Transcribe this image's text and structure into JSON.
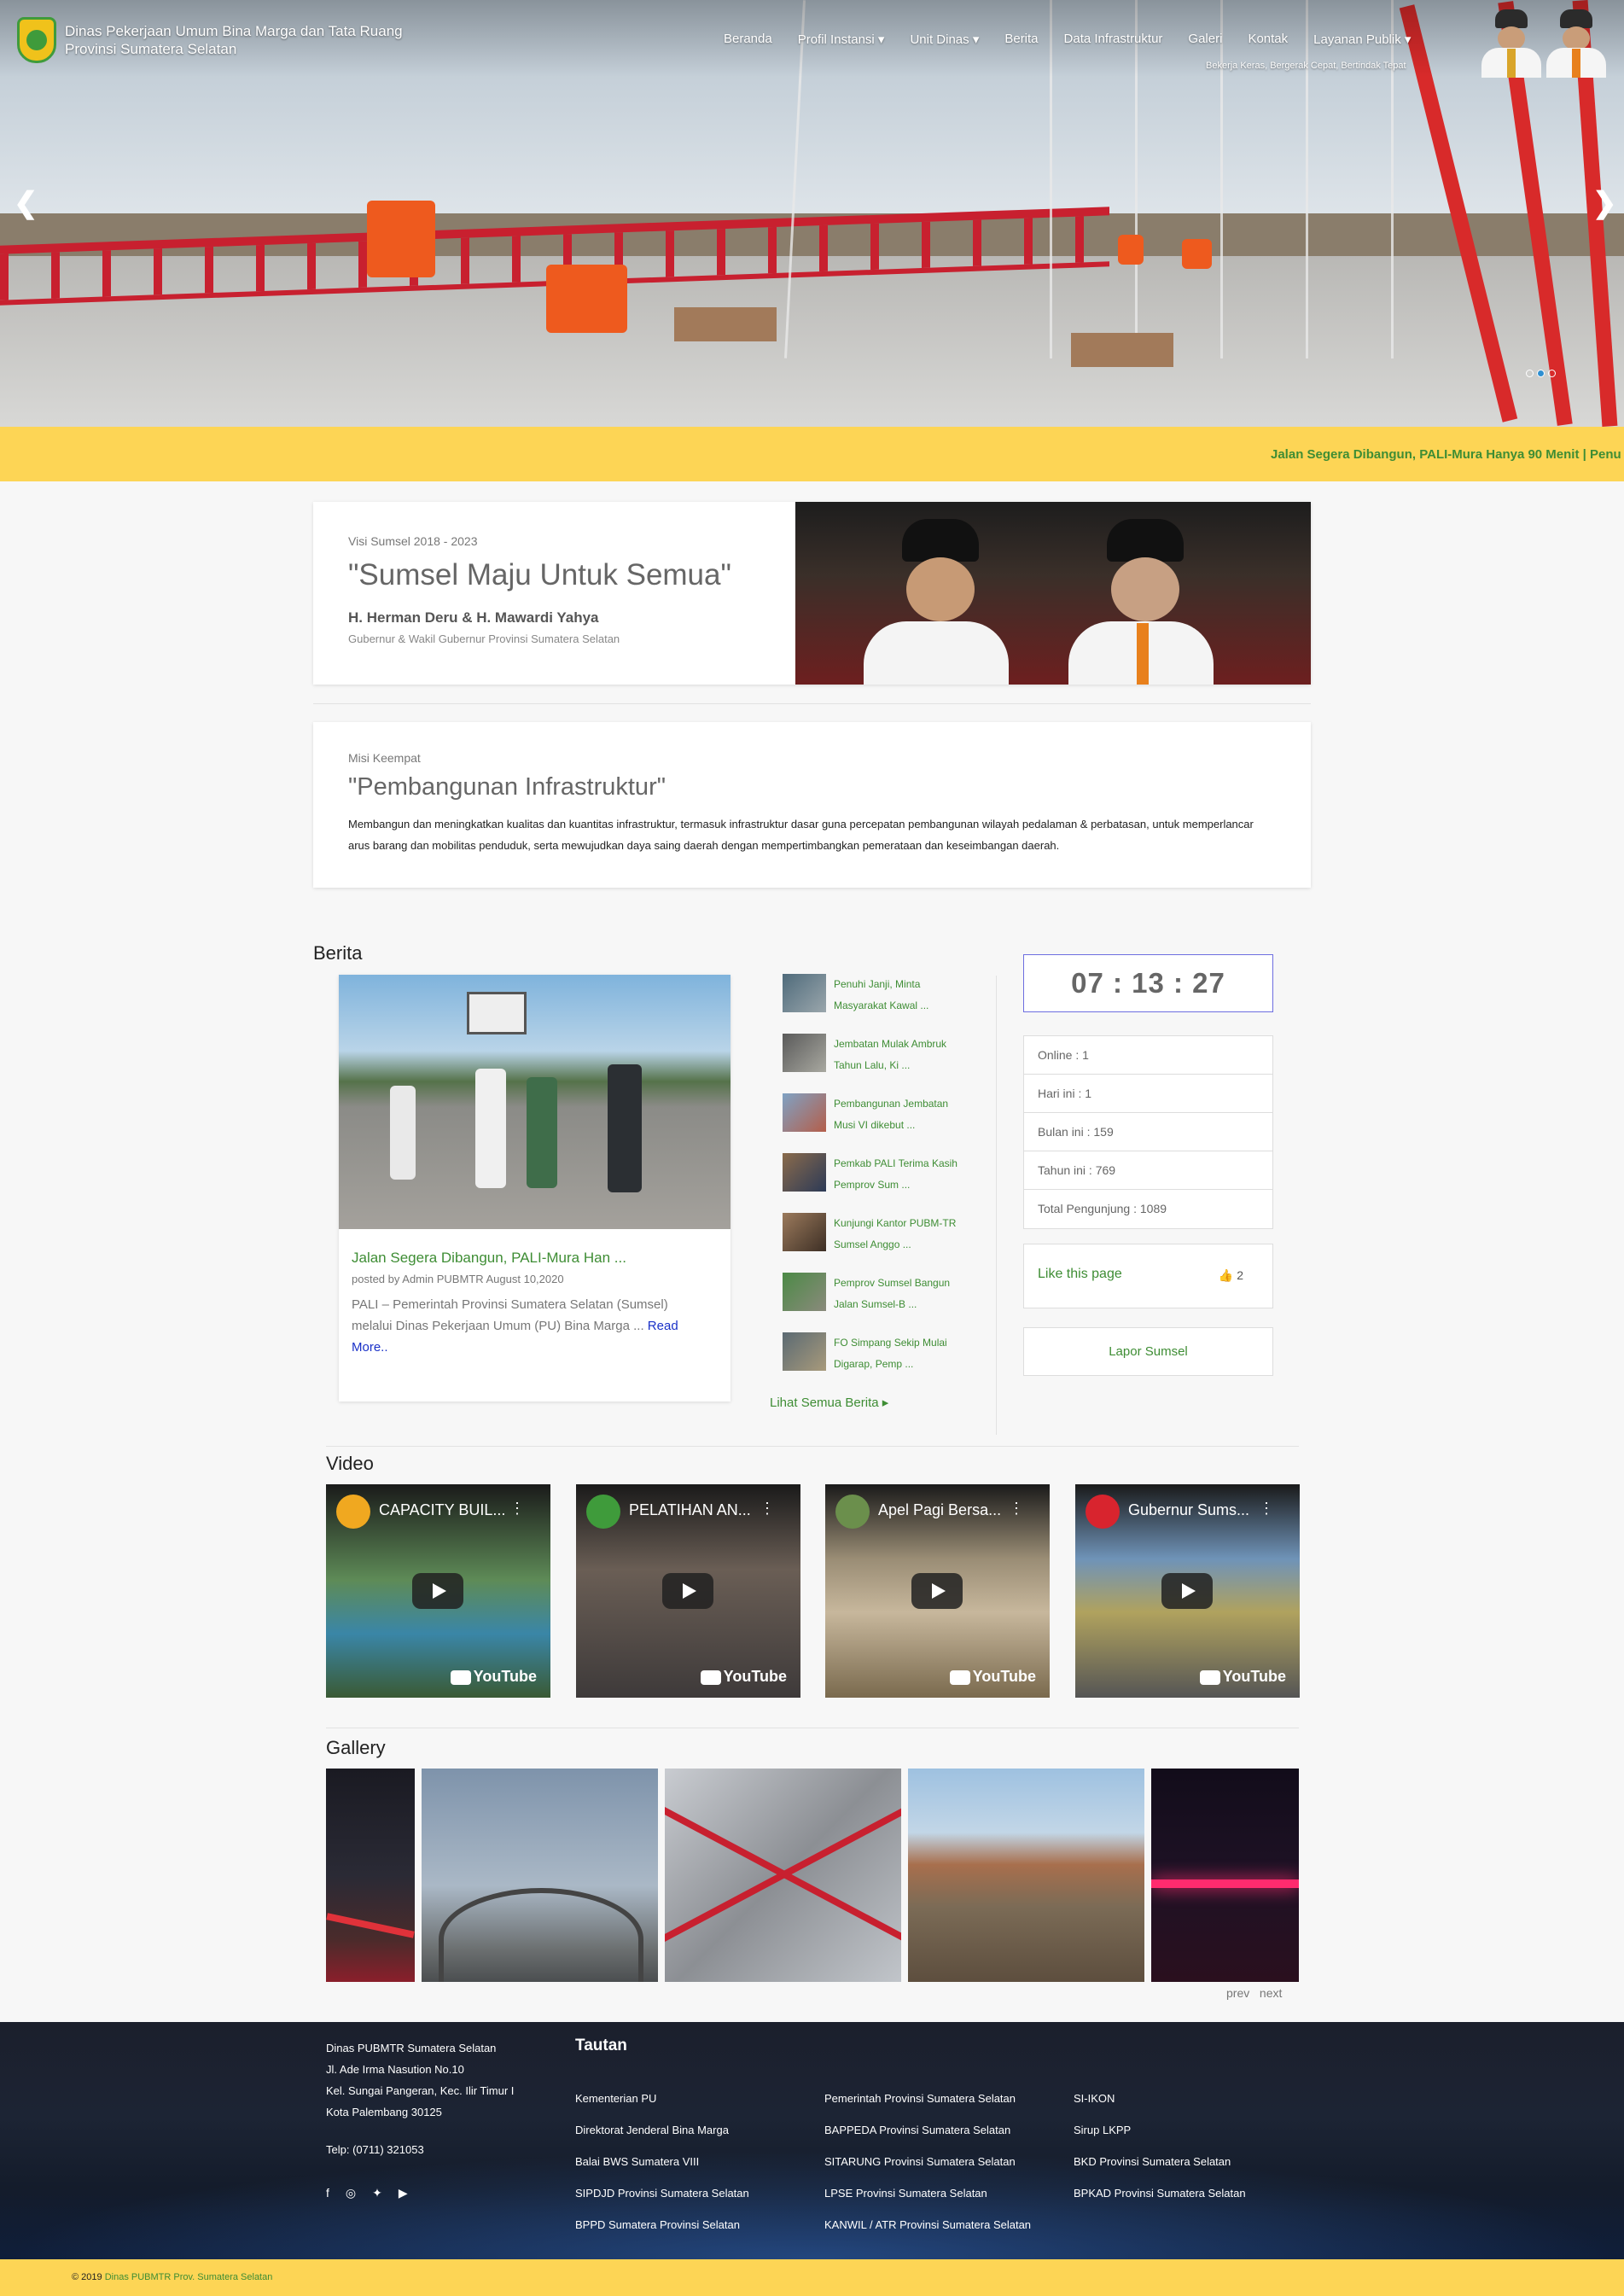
{
  "header": {
    "brand_line1": "Dinas Pekerjaan Umum Bina Marga dan Tata Ruang",
    "brand_line2": "Provinsi Sumatera Selatan",
    "menu": [
      "Beranda",
      "Profil Instansi ▾",
      "Unit Dinas ▾",
      "Berita",
      "Data Infrastruktur",
      "Galeri",
      "Kontak",
      "Layanan Publik ▾"
    ],
    "tagline": "Bekerja Keras, Bergerak Cepat, Bertindak Tepat"
  },
  "slider": {
    "prev_icon": "chevron-left-icon",
    "next_icon": "chevron-right-icon",
    "slide_count": 3,
    "active_slide": 2
  },
  "ticker": {
    "text": "Jalan Segera Dibangun, PALI-Mura Hanya 90 Menit  |  Penu"
  },
  "visi": {
    "label": "Visi Sumsel 2018 - 2023",
    "title": "\"Sumsel Maju Untuk Semua\"",
    "names": "H. Herman Deru & H. Mawardi Yahya",
    "role": "Gubernur & Wakil Gubernur Provinsi Sumatera Selatan"
  },
  "misi": {
    "label": "Misi Keempat",
    "title": "\"Pembangunan Infrastruktur\"",
    "text": "Membangun dan meningkatkan kualitas dan kuantitas infrastruktur, termasuk infrastruktur dasar guna percepatan pembangunan wilayah pedalaman & perbatasan, untuk memperlancar arus barang dan mobilitas penduduk, serta mewujudkan daya saing daerah dengan mempertimbangkan pemerataan dan keseimbangan daerah."
  },
  "berita": {
    "heading": "Berita",
    "main": {
      "title": "Jalan Segera Dibangun, PALI-Mura Han ...",
      "meta": "posted by Admin PUBMTR August 10,2020",
      "excerpt": "PALI – Pemerintah Provinsi Sumatera Selatan (Sumsel) melalui Dinas Pekerjaan Umum (PU) Bina Marga ...",
      "read_more": "Read More.."
    },
    "list": [
      "Penuhi Janji, Minta Masyarakat Kawal ...",
      "Jembatan Mulak Ambruk Tahun Lalu, Ki ...",
      "Pembangunan Jembatan Musi VI dikebut ...",
      "Pemkab PALI Terima Kasih Pemprov Sum ...",
      "Kunjungi Kantor PUBM-TR Sumsel Anggo ...",
      "Pemprov Sumsel Bangun Jalan Sumsel-B ...",
      "FO Simpang Sekip Mulai Digarap, Pemp ..."
    ],
    "see_all": "Lihat Semua Berita ▸"
  },
  "sidebar": {
    "clock": "07 : 13 : 27",
    "stats": [
      "Online : 1",
      "Hari ini : 1",
      "Bulan ini : 159",
      "Tahun ini : 769",
      "Total Pengunjung : 1089"
    ],
    "like_label": "Like this page",
    "like_count": "2",
    "lapor": "Lapor Sumsel"
  },
  "video": {
    "heading": "Video",
    "items": [
      {
        "title": "CAPACITY BUIL...",
        "color": "#2f6f3a"
      },
      {
        "title": "PELATIHAN AN...",
        "color": "#4b4a44"
      },
      {
        "title": "Apel Pagi Bersa...",
        "color": "#6b5e4c"
      },
      {
        "title": "Gubernur Sums...",
        "color": "#3c4f66"
      }
    ],
    "yt_label": "YouTube"
  },
  "gallery": {
    "heading": "Gallery",
    "prev": "prev",
    "next": "next"
  },
  "footer": {
    "address": [
      "Dinas PUBMTR Sumatera Selatan",
      "Jl. Ade Irma Nasution No.10",
      "Kel. Sungai Pangeran, Kec. Ilir Timur I",
      "Kota Palembang 30125"
    ],
    "phone": "Telp: (0711) 321053",
    "social": [
      "facebook-icon",
      "instagram-icon",
      "twitter-icon",
      "youtube-icon"
    ],
    "tautan_title": "Tautan",
    "col1": [
      "Kementerian PU",
      "Direktorat Jenderal Bina Marga",
      "Balai BWS Sumatera VIII",
      "SIPDJD Provinsi Sumatera Selatan",
      "BPPD Sumatera Provinsi Selatan"
    ],
    "col2": [
      "Pemerintah Provinsi Sumatera Selatan",
      "BAPPEDA Provinsi Sumatera Selatan",
      "SITARUNG Provinsi Sumatera Selatan",
      "LPSE Provinsi Sumatera Selatan",
      "KANWIL / ATR Provinsi Sumatera Selatan"
    ],
    "col3": [
      "SI-IKON",
      "Sirup LKPP",
      "BKD Provinsi Sumatera Selatan",
      "BPKAD Provinsi Sumatera Selatan"
    ],
    "copyright_prefix": "© 2019 ",
    "copyright_link": "Dinas PUBMTR Prov. Sumatera Selatan"
  }
}
